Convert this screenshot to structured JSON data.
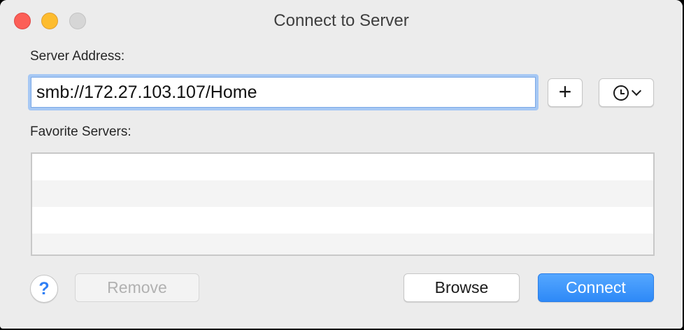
{
  "window": {
    "title": "Connect to Server"
  },
  "server_address": {
    "label": "Server Address:",
    "value": "smb://172.27.103.107/Home",
    "placeholder": ""
  },
  "icons": {
    "add": "plus-icon",
    "recent": "clock-icon",
    "dropdown": "chevron-down-icon",
    "help": "question-mark-icon"
  },
  "favorites": {
    "label": "Favorite Servers:",
    "rows": 4
  },
  "buttons": {
    "help": "?",
    "add": "+",
    "remove": "Remove",
    "browse": "Browse",
    "connect": "Connect"
  },
  "colors": {
    "accent": "#2e89f7",
    "close": "#fc5f57",
    "minimize": "#fdbc2e"
  }
}
